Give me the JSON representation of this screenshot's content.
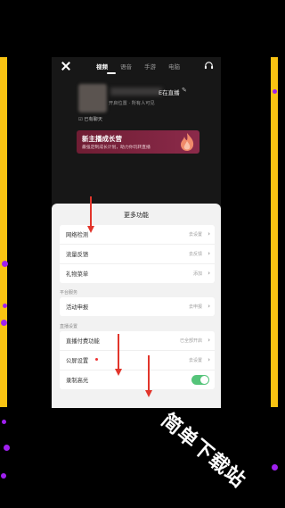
{
  "top_tabs": [
    "视频",
    "语音",
    "手游",
    "电脑"
  ],
  "header": {
    "title_suffix": "E在直播",
    "location": "开启位置 · 所有人可见",
    "chat_line": "☑ 已有聊天"
  },
  "banner": {
    "title": "新主播成长营",
    "subtitle": "最强定制成长计划，助力你玩转直播"
  },
  "sheet": {
    "title": "更多功能",
    "group1": [
      {
        "label": "网络检测",
        "value": "去设置"
      },
      {
        "label": "流量反馈",
        "value": "去反馈"
      },
      {
        "label": "礼物菜单",
        "value": "添加"
      }
    ],
    "section_platform": "平台服务",
    "group2": [
      {
        "label": "活动申报",
        "value": "去申报"
      }
    ],
    "section_live": "直播设置",
    "group3": [
      {
        "label": "直播付费功能",
        "value": "已全部开启"
      },
      {
        "label": "公屏设置",
        "value": "去设置"
      },
      {
        "label": "录制高光",
        "toggle": true
      }
    ]
  },
  "watermark": "简单下载站",
  "colors": {
    "frame": "#f9c312",
    "dots": "#a020f0",
    "arrows": "#e2352b",
    "toggle_on": "#55c47a",
    "banner": "#7a2240"
  }
}
